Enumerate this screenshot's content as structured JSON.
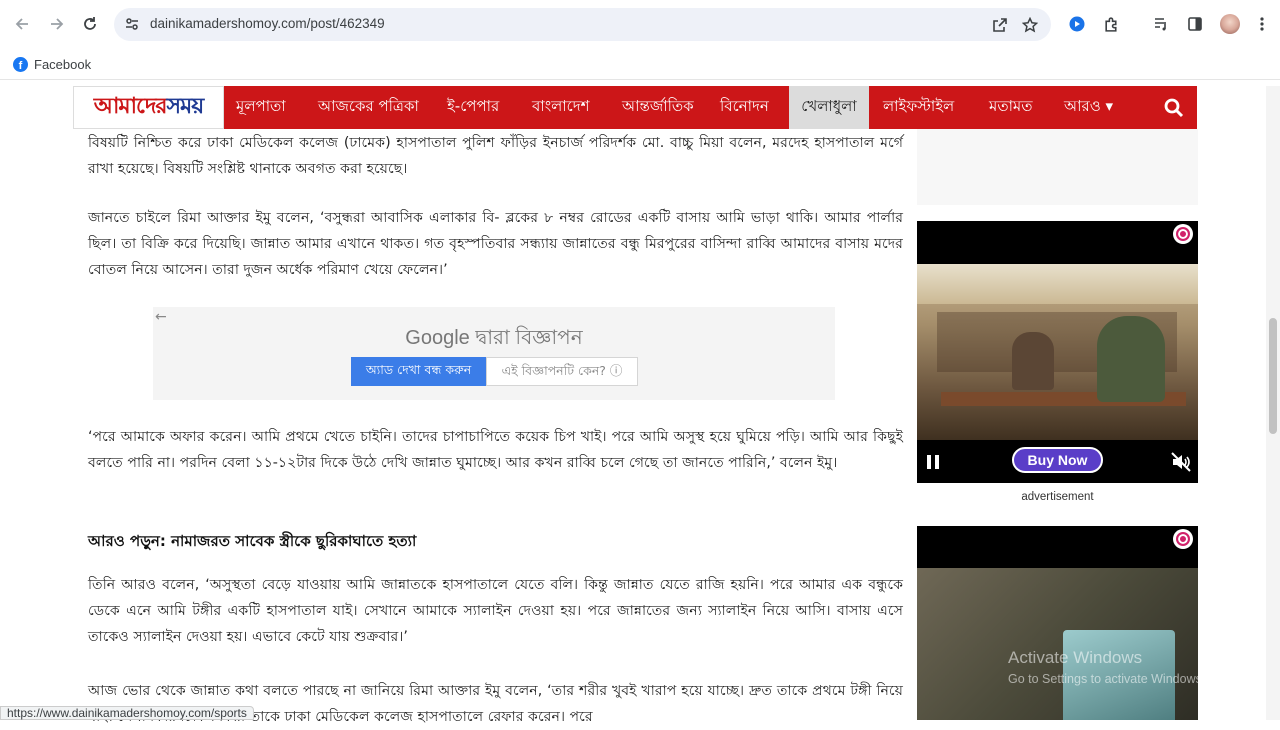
{
  "browser": {
    "url": "dainikamadershomoy.com/post/462349",
    "bookmark_label": "Facebook",
    "status_url": "https://www.dainikamadershomoy.com/sports"
  },
  "site": {
    "logo_part1": "আমাদের",
    "logo_part2": "সময়",
    "menu": [
      {
        "label": "মূলপাতা"
      },
      {
        "label": "আজকের পত্রিকা"
      },
      {
        "label": "ই-পেপার"
      },
      {
        "label": "বাংলাদেশ"
      },
      {
        "label": "আন্তর্জাতিক"
      },
      {
        "label": "বিনোদন"
      },
      {
        "label": "খেলাধুলা"
      },
      {
        "label": "লাইফস্টাইল"
      },
      {
        "label": "মতামত"
      },
      {
        "label": "আরও ▾"
      }
    ]
  },
  "article": {
    "p1": "বিষয়টি নিশ্চিত করে ঢাকা মেডিকেল কলেজ (ঢামেক) হাসপাতাল পুলিশ ফাঁড়ির ইনচার্জ পরিদর্শক মো. বাচ্চু মিয়া বলেন, মরদেহ হাসপাতাল মর্গে রাখা হয়েছে। বিষয়টি সংশ্লিষ্ট থানাকে অবগত করা হয়েছে।",
    "p2": "জানতে চাইলে রিমা আক্তার ইমু বলেন, ‘বসুন্ধরা আবাসিক এলাকার বি- ব্লকের ৮ নম্বর রোডের একটি বাসায় আমি ভাড়া থাকি। আমার পার্লার ছিল। তা বিক্রি করে দিয়েছি। জান্নাত আমার এখানে থাকত। গত বৃহস্পতিবার সন্ধ্যায় জান্নাতের বন্ধু মিরপুরের বাসিন্দা রাব্বি আমাদের বাসায় মদের বোতল নিয়ে আসেন। তারা দুজন অর্ধেক পরিমাণ খেয়ে ফেলেন।’",
    "p3": "‘পরে আমাকে অফার করেন। আমি প্রথমে খেতে চাইনি। তাদের চাপাচাপিতে কয়েক চিপ খাই। পরে আমি অসুস্থ হয়ে ঘুমিয়ে পড়ি। আমি আর কিছুই বলতে পারি না। পরদিন বেলা ১১-১২টার দিকে উঠে দেখি জান্নাত ঘুমাচ্ছে। আর কখন রাব্বি চলে গেছে তা জানতে পারিনি,’ বলেন ইমু।",
    "read_more": "আরও পড়ুন: নামাজরত সাবেক স্ত্রীকে ছুরিকাঘাতে হত্যা",
    "p4": "তিনি আরও বলেন, ‘অসুস্থতা বেড়ে যাওয়ায় আমি জান্নাতকে হাসপাতালে যেতে বলি। কিন্তু জান্নাত যেতে রাজি হয়নি। পরে আমার এক বন্ধুকে ডেকে এনে আমি টঙ্গীর একটি হাসপাতাল যাই। সেখানে আমাকে স্যালাইন দেওয়া হয়। পরে জান্নাতের জন্য স্যালাইন নিয়ে আসি। বাসায় এসে তাকেও স্যালাইন দেওয়া হয়। এভাবে কেটে যায় শুক্রবার।’",
    "p5": "আজ ভোর থেকে জান্নাত কথা বলতে পারছে না জানিয়ে রিমা আক্তার ইমু বলেন, ‘তার শরীর খুবই খারাপ হয়ে যাচ্ছে। দ্রুত তাকে প্রথমে টঙ্গী নিয়ে যাই। সেখানকার চিকিৎসকরা তাকে ঢাকা মেডিকেল কলেজ হাসপাতালে রেফার করেন। পরে"
  },
  "google_ad": {
    "title": "Google দ্বারা বিজ্ঞাপন",
    "stop_button": "অ্যাড দেখা বন্ধ করুন",
    "why_button": "এই বিজ্ঞাপনটি কেন? ⓘ"
  },
  "sidebar": {
    "buy_now": "Buy Now",
    "advertisement_label": "advertisement"
  },
  "watermark": {
    "line1": "Activate Windows",
    "line2": "Go to Settings to activate Windows."
  },
  "colors": {
    "brand_red": "#cc1618",
    "active_menu_bg": "#dcdcdc",
    "ad_button_blue": "#3b7de8",
    "buy_now_purple": "#5a3ec8"
  }
}
